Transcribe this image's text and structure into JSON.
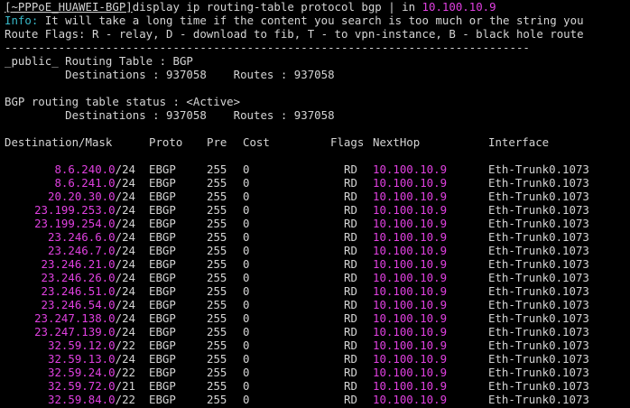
{
  "command": {
    "prompt": "[~PPPoE_HUAWEI-BGP]",
    "text": "display ip routing-table protocol bgp | in ",
    "arg": "10.100.10.9"
  },
  "info": {
    "label": "Info:",
    "text": " It will take a long time if the content you search is too much or the string you"
  },
  "route_flags": "Route Flags: R - relay, D - download to fib, T - to vpn-instance, B - black hole route",
  "separator": "------------------------------------------------------------------------------",
  "public_table": {
    "title": "_public_ Routing Table : BGP",
    "summary": "         Destinations : 937058    Routes : 937058"
  },
  "status_table": {
    "title": "BGP routing table status : <Active>",
    "summary": "         Destinations : 937058    Routes : 937058"
  },
  "headers": {
    "destination": "Destination/Mask",
    "proto": "Proto",
    "pre": "Pre",
    "cost": "Cost",
    "flags": "Flags",
    "nexthop": "NextHop",
    "interface": "Interface"
  },
  "routes": [
    {
      "net": "8.6.240.0",
      "mask": "/24",
      "proto": "EBGP",
      "pre": "255",
      "cost": "0",
      "flags": "RD",
      "nexthop": "10.100.10.9",
      "iface": "Eth-Trunk0.1073"
    },
    {
      "net": "8.6.241.0",
      "mask": "/24",
      "proto": "EBGP",
      "pre": "255",
      "cost": "0",
      "flags": "RD",
      "nexthop": "10.100.10.9",
      "iface": "Eth-Trunk0.1073"
    },
    {
      "net": "20.20.30.0",
      "mask": "/24",
      "proto": "EBGP",
      "pre": "255",
      "cost": "0",
      "flags": "RD",
      "nexthop": "10.100.10.9",
      "iface": "Eth-Trunk0.1073"
    },
    {
      "net": "23.199.253.0",
      "mask": "/24",
      "proto": "EBGP",
      "pre": "255",
      "cost": "0",
      "flags": "RD",
      "nexthop": "10.100.10.9",
      "iface": "Eth-Trunk0.1073"
    },
    {
      "net": "23.199.254.0",
      "mask": "/24",
      "proto": "EBGP",
      "pre": "255",
      "cost": "0",
      "flags": "RD",
      "nexthop": "10.100.10.9",
      "iface": "Eth-Trunk0.1073"
    },
    {
      "net": "23.246.6.0",
      "mask": "/24",
      "proto": "EBGP",
      "pre": "255",
      "cost": "0",
      "flags": "RD",
      "nexthop": "10.100.10.9",
      "iface": "Eth-Trunk0.1073"
    },
    {
      "net": "23.246.7.0",
      "mask": "/24",
      "proto": "EBGP",
      "pre": "255",
      "cost": "0",
      "flags": "RD",
      "nexthop": "10.100.10.9",
      "iface": "Eth-Trunk0.1073"
    },
    {
      "net": "23.246.21.0",
      "mask": "/24",
      "proto": "EBGP",
      "pre": "255",
      "cost": "0",
      "flags": "RD",
      "nexthop": "10.100.10.9",
      "iface": "Eth-Trunk0.1073"
    },
    {
      "net": "23.246.26.0",
      "mask": "/24",
      "proto": "EBGP",
      "pre": "255",
      "cost": "0",
      "flags": "RD",
      "nexthop": "10.100.10.9",
      "iface": "Eth-Trunk0.1073"
    },
    {
      "net": "23.246.51.0",
      "mask": "/24",
      "proto": "EBGP",
      "pre": "255",
      "cost": "0",
      "flags": "RD",
      "nexthop": "10.100.10.9",
      "iface": "Eth-Trunk0.1073"
    },
    {
      "net": "23.246.54.0",
      "mask": "/24",
      "proto": "EBGP",
      "pre": "255",
      "cost": "0",
      "flags": "RD",
      "nexthop": "10.100.10.9",
      "iface": "Eth-Trunk0.1073"
    },
    {
      "net": "23.247.138.0",
      "mask": "/24",
      "proto": "EBGP",
      "pre": "255",
      "cost": "0",
      "flags": "RD",
      "nexthop": "10.100.10.9",
      "iface": "Eth-Trunk0.1073"
    },
    {
      "net": "23.247.139.0",
      "mask": "/24",
      "proto": "EBGP",
      "pre": "255",
      "cost": "0",
      "flags": "RD",
      "nexthop": "10.100.10.9",
      "iface": "Eth-Trunk0.1073"
    },
    {
      "net": "32.59.12.0",
      "mask": "/22",
      "proto": "EBGP",
      "pre": "255",
      "cost": "0",
      "flags": "RD",
      "nexthop": "10.100.10.9",
      "iface": "Eth-Trunk0.1073"
    },
    {
      "net": "32.59.13.0",
      "mask": "/24",
      "proto": "EBGP",
      "pre": "255",
      "cost": "0",
      "flags": "RD",
      "nexthop": "10.100.10.9",
      "iface": "Eth-Trunk0.1073"
    },
    {
      "net": "32.59.24.0",
      "mask": "/22",
      "proto": "EBGP",
      "pre": "255",
      "cost": "0",
      "flags": "RD",
      "nexthop": "10.100.10.9",
      "iface": "Eth-Trunk0.1073"
    },
    {
      "net": "32.59.72.0",
      "mask": "/21",
      "proto": "EBGP",
      "pre": "255",
      "cost": "0",
      "flags": "RD",
      "nexthop": "10.100.10.9",
      "iface": "Eth-Trunk0.1073"
    },
    {
      "net": "32.59.84.0",
      "mask": "/22",
      "proto": "EBGP",
      "pre": "255",
      "cost": "0",
      "flags": "RD",
      "nexthop": "10.100.10.9",
      "iface": "Eth-Trunk0.1073"
    }
  ],
  "colors": {
    "background": "#000000",
    "text": "#d4d4d4",
    "highlight": "#e040e0",
    "info": "#38b8c8"
  }
}
